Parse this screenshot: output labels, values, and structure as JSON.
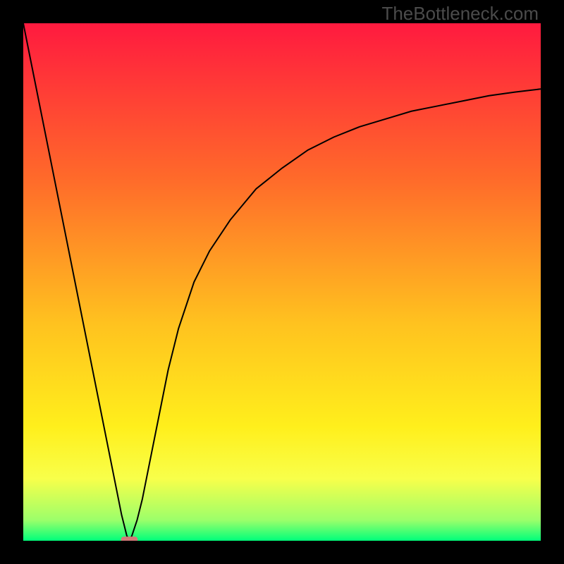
{
  "watermark": "TheBottleneck.com",
  "chart_data": {
    "type": "line",
    "title": "",
    "xlabel": "",
    "ylabel": "",
    "xlim": [
      0,
      100
    ],
    "ylim": [
      0,
      100
    ],
    "background": {
      "gradient": [
        "#ff1a3f",
        "#ff6a2a",
        "#ffc21f",
        "#ffef1c",
        "#f8ff4a",
        "#9cff6a",
        "#00ff7b"
      ],
      "stops": [
        0,
        0.3,
        0.58,
        0.78,
        0.88,
        0.96,
        1.0
      ]
    },
    "series": [
      {
        "name": "bottleneck-curve",
        "color": "#000000",
        "x": [
          0,
          2,
          4,
          6,
          8,
          10,
          12,
          14,
          16,
          18,
          19,
          20,
          20.5,
          21,
          22,
          23,
          24,
          26,
          28,
          30,
          33,
          36,
          40,
          45,
          50,
          55,
          60,
          65,
          70,
          75,
          80,
          85,
          90,
          95,
          100
        ],
        "y": [
          100,
          90,
          80,
          70,
          60,
          50,
          40,
          30,
          20,
          10,
          5,
          1,
          0,
          1,
          4,
          8,
          13,
          23,
          33,
          41,
          50,
          56,
          62,
          68,
          72,
          75.5,
          78,
          80,
          81.5,
          83,
          84,
          85,
          86,
          86.7,
          87.3
        ]
      }
    ],
    "marker": {
      "name": "optimal-marker",
      "x": 20.5,
      "y": 0,
      "color": "#d27878",
      "width_pct": 3.2,
      "height_pct": 1.6
    }
  }
}
